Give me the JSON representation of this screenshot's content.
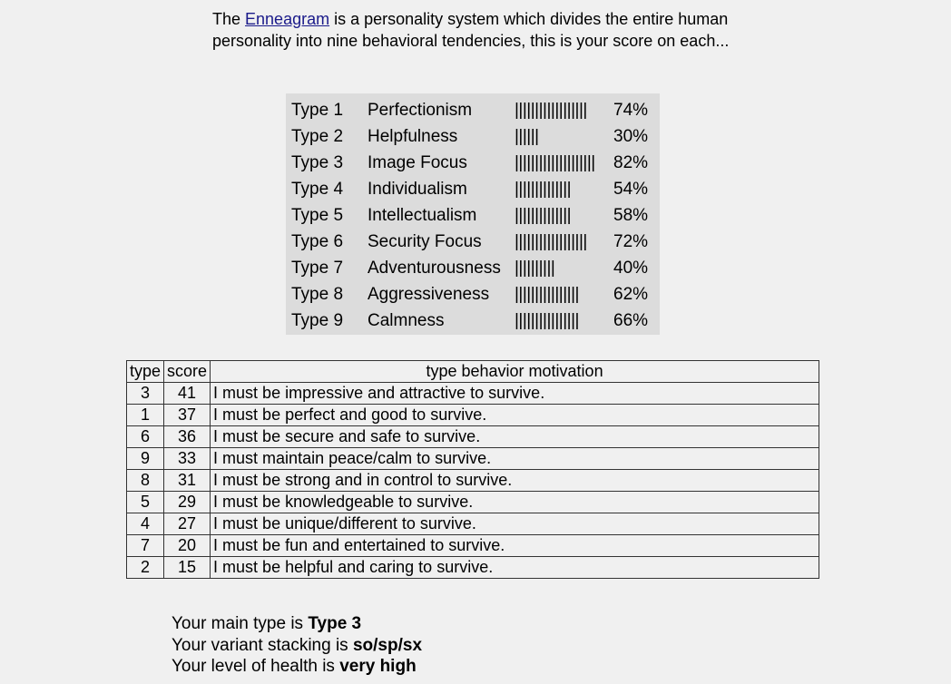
{
  "intro": {
    "prefix": "The ",
    "link_text": "Enneagram",
    "suffix": " is a personality system which divides the entire human personality into nine behavioral tendencies, this is your score on each..."
  },
  "scores": [
    {
      "type": "Type 1",
      "name": "Perfectionism",
      "bar": "||||||||||||||||||",
      "percent": "74%"
    },
    {
      "type": "Type 2",
      "name": "Helpfulness",
      "bar": "||||||",
      "percent": "30%"
    },
    {
      "type": "Type 3",
      "name": "Image Focus",
      "bar": "||||||||||||||||||||",
      "percent": "82%"
    },
    {
      "type": "Type 4",
      "name": "Individualism",
      "bar": "||||||||||||||",
      "percent": "54%"
    },
    {
      "type": "Type 5",
      "name": "Intellectualism",
      "bar": "||||||||||||||",
      "percent": "58%"
    },
    {
      "type": "Type 6",
      "name": "Security Focus",
      "bar": "||||||||||||||||||",
      "percent": "72%"
    },
    {
      "type": "Type 7",
      "name": "Adventurousness",
      "bar": "||||||||||",
      "percent": "40%"
    },
    {
      "type": "Type 8",
      "name": "Aggressiveness",
      "bar": "||||||||||||||||",
      "percent": "62%"
    },
    {
      "type": "Type 9",
      "name": "Calmness",
      "bar": "||||||||||||||||",
      "percent": "66%"
    }
  ],
  "table": {
    "headers": [
      "type",
      "score",
      "type behavior motivation"
    ],
    "rows": [
      {
        "type": "3",
        "score": "41",
        "motivation": "I must be impressive and attractive to survive."
      },
      {
        "type": "1",
        "score": "37",
        "motivation": "I must be perfect and good to survive."
      },
      {
        "type": "6",
        "score": "36",
        "motivation": "I must be secure and safe to survive."
      },
      {
        "type": "9",
        "score": "33",
        "motivation": "I must maintain peace/calm to survive."
      },
      {
        "type": "8",
        "score": "31",
        "motivation": "I must be strong and in control to survive."
      },
      {
        "type": "5",
        "score": "29",
        "motivation": "I must be knowledgeable to survive."
      },
      {
        "type": "4",
        "score": "27",
        "motivation": "I must be unique/different to survive."
      },
      {
        "type": "7",
        "score": "20",
        "motivation": "I must be fun and entertained to survive."
      },
      {
        "type": "2",
        "score": "15",
        "motivation": "I must be helpful and caring to survive."
      }
    ]
  },
  "summary": {
    "main_type_label": "Your main type is ",
    "main_type_value": "Type 3",
    "stacking_label": "Your variant stacking is ",
    "stacking_value": "so/sp/sx",
    "health_label": "Your level of health is ",
    "health_value": "very high"
  },
  "colors": {
    "page_background": "#f0f0f0",
    "score_panel_background": "#dcdcdc",
    "link": "#1a1a8a"
  }
}
